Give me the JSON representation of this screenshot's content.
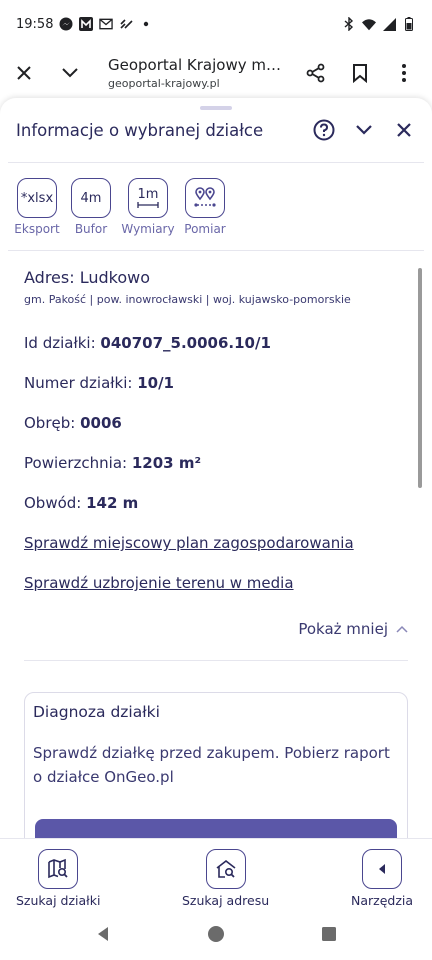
{
  "status_bar": {
    "time": "19:58",
    "left_icons": [
      "messenger-icon",
      "m-box-icon",
      "gmail-icon",
      "chevrons-icon",
      "dot-icon"
    ],
    "right_icons": [
      "bluetooth-icon",
      "wifi-icon",
      "signal-icon",
      "battery-icon"
    ]
  },
  "browser": {
    "title": "Geoportal Krajowy mapy...",
    "url": "geoportal-krajowy.pl"
  },
  "panel": {
    "title": "Informacje o wybranej działce"
  },
  "tools": [
    {
      "icon_text": "*xlsx",
      "label": "Eksport"
    },
    {
      "icon_text": "4m",
      "label": "Bufor"
    },
    {
      "icon_text": "1m",
      "label": "Wymiary"
    },
    {
      "icon_text": "",
      "label": "Pomiar"
    }
  ],
  "address": {
    "title": "Adres: Ludkowo",
    "subtitle": "gm. Pakość | pow. inowrocławski | woj. kujawsko-pomorskie"
  },
  "fields": [
    {
      "label": "Id działki: ",
      "value": "040707_5.0006.10/1"
    },
    {
      "label": "Numer działki: ",
      "value": "10/1"
    },
    {
      "label": "Obręb: ",
      "value": "0006"
    },
    {
      "label": "Powierzchnia: ",
      "value": "1203 m²"
    },
    {
      "label": "Obwód: ",
      "value": "142 m"
    }
  ],
  "links": [
    "Sprawdź miejscowy plan zagospodarowania",
    "Sprawdź uzbrojenie terenu w media"
  ],
  "show_less": "Pokaż mniej",
  "diagnosis": {
    "title": "Diagnoza działki",
    "text": "Sprawdź działkę przed zakupem. Pobierz raport o działce OnGeo.pl"
  },
  "bottom_nav": [
    {
      "label": "Szukaj działki",
      "icon": "map-search-icon"
    },
    {
      "label": "Szukaj adresu",
      "icon": "home-search-icon"
    },
    {
      "label": "Narzędzia",
      "icon": "arrow-left-icon"
    }
  ],
  "colors": {
    "primary": "#2b2a5c",
    "accent": "#4a468f",
    "button": "#5b57a8"
  }
}
